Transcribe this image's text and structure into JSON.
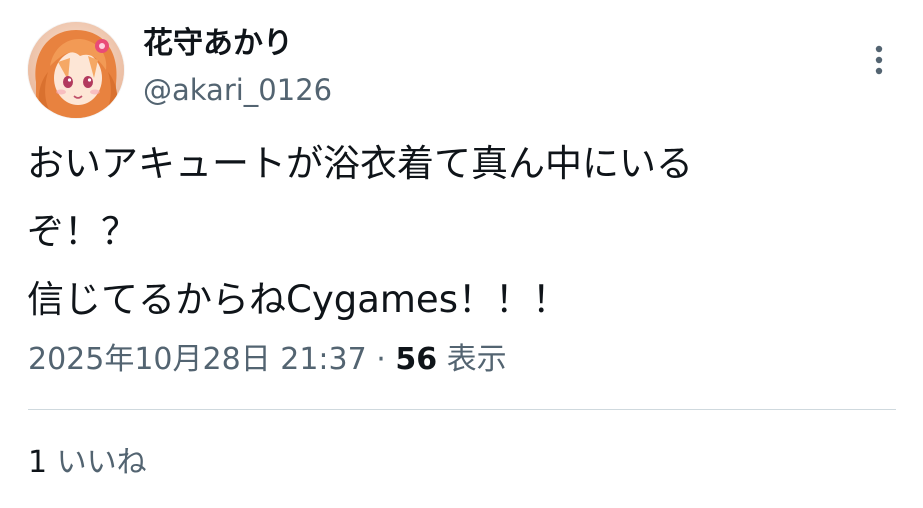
{
  "author": {
    "display_name": "花守あかり",
    "handle": "@akari_0126",
    "avatar_icon": "anime-character-avatar-icon"
  },
  "menu": {
    "icon": "more-vertical-icon"
  },
  "tweet": {
    "lines": [
      "おいアキュートが浴衣着て真ん中にいる",
      "ぞ！？",
      "信じてるからねCygames！！！"
    ]
  },
  "meta": {
    "timestamp": "2025年10月28日 21:37",
    "separator": "·",
    "views_count": "56",
    "views_label": "表示"
  },
  "engagement": {
    "likes_count": "1",
    "likes_label": "いいね"
  },
  "colors": {
    "text_primary": "#0f1419",
    "text_secondary": "#536471",
    "divider": "#cfd9de"
  }
}
